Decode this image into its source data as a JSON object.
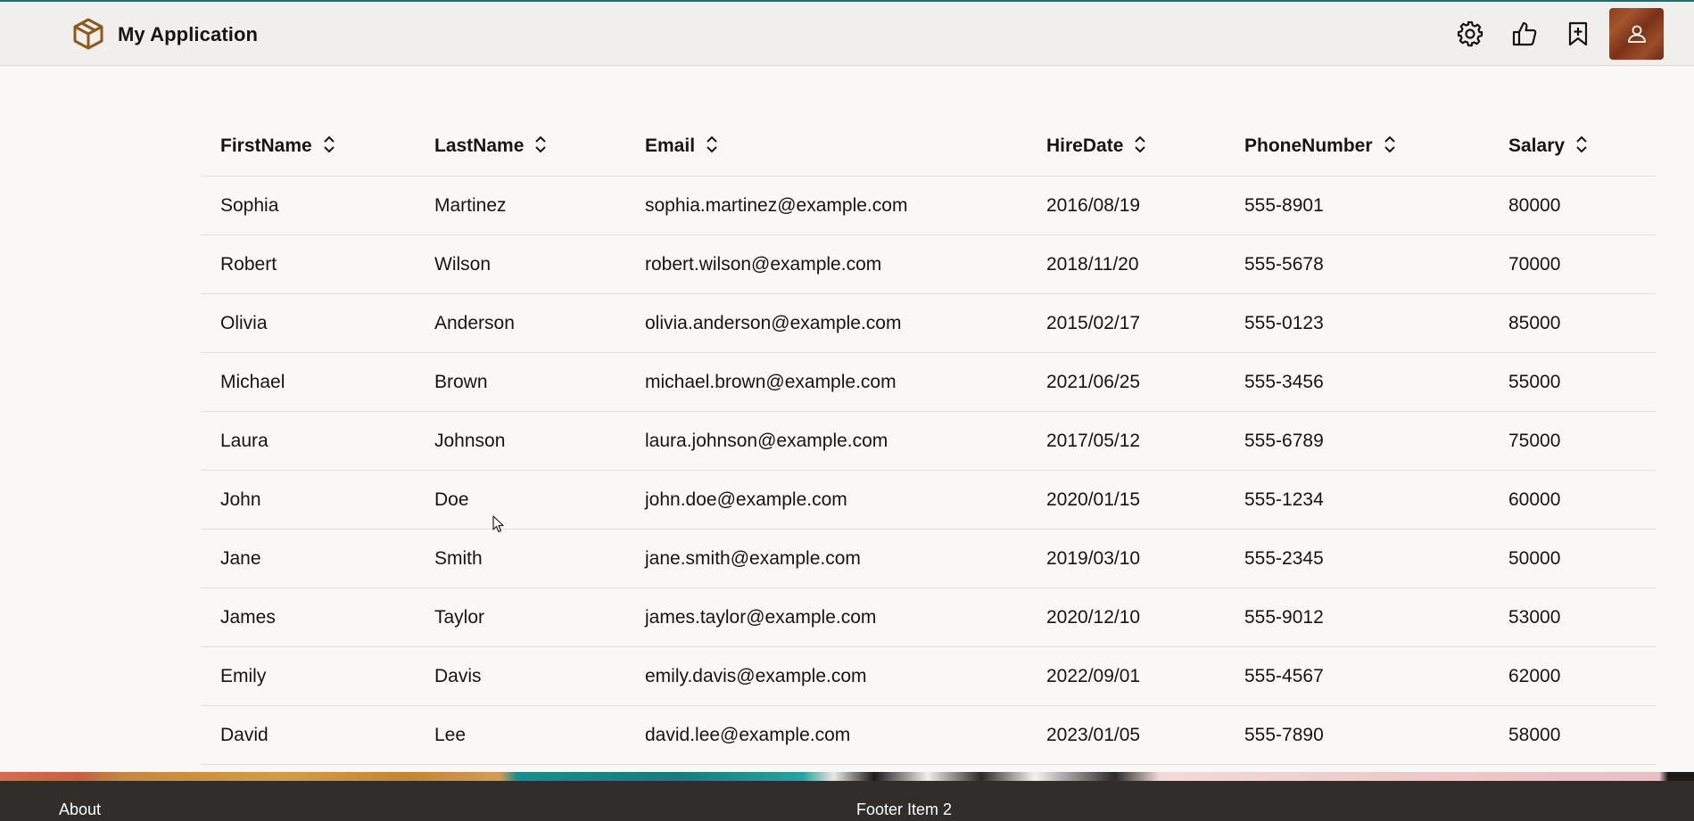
{
  "header": {
    "app_title": "My Application",
    "logo_icon": "cube-icon",
    "buttons": [
      {
        "icon": "gear-icon"
      },
      {
        "icon": "thumbs-up-icon"
      },
      {
        "icon": "bookmark-add-icon"
      },
      {
        "icon": "user-icon"
      }
    ],
    "accent_color": "#1f6f6d",
    "brand_color": "#8b5a1c"
  },
  "table": {
    "columns": [
      "FirstName",
      "LastName",
      "Email",
      "HireDate",
      "PhoneNumber",
      "Salary"
    ],
    "rows": [
      [
        "Sophia",
        "Martinez",
        "sophia.martinez@example.com",
        "2016/08/19",
        "555-8901",
        "80000"
      ],
      [
        "Robert",
        "Wilson",
        "robert.wilson@example.com",
        "2018/11/20",
        "555-5678",
        "70000"
      ],
      [
        "Olivia",
        "Anderson",
        "olivia.anderson@example.com",
        "2015/02/17",
        "555-0123",
        "85000"
      ],
      [
        "Michael",
        "Brown",
        "michael.brown@example.com",
        "2021/06/25",
        "555-3456",
        "55000"
      ],
      [
        "Laura",
        "Johnson",
        "laura.johnson@example.com",
        "2017/05/12",
        "555-6789",
        "75000"
      ],
      [
        "John",
        "Doe",
        "john.doe@example.com",
        "2020/01/15",
        "555-1234",
        "60000"
      ],
      [
        "Jane",
        "Smith",
        "jane.smith@example.com",
        "2019/03/10",
        "555-2345",
        "50000"
      ],
      [
        "James",
        "Taylor",
        "james.taylor@example.com",
        "2020/12/10",
        "555-9012",
        "53000"
      ],
      [
        "Emily",
        "Davis",
        "emily.davis@example.com",
        "2022/09/01",
        "555-4567",
        "62000"
      ],
      [
        "David",
        "Lee",
        "david.lee@example.com",
        "2023/01/05",
        "555-7890",
        "58000"
      ]
    ]
  },
  "footer": {
    "items": [
      "About",
      "Footer Item 2"
    ]
  }
}
